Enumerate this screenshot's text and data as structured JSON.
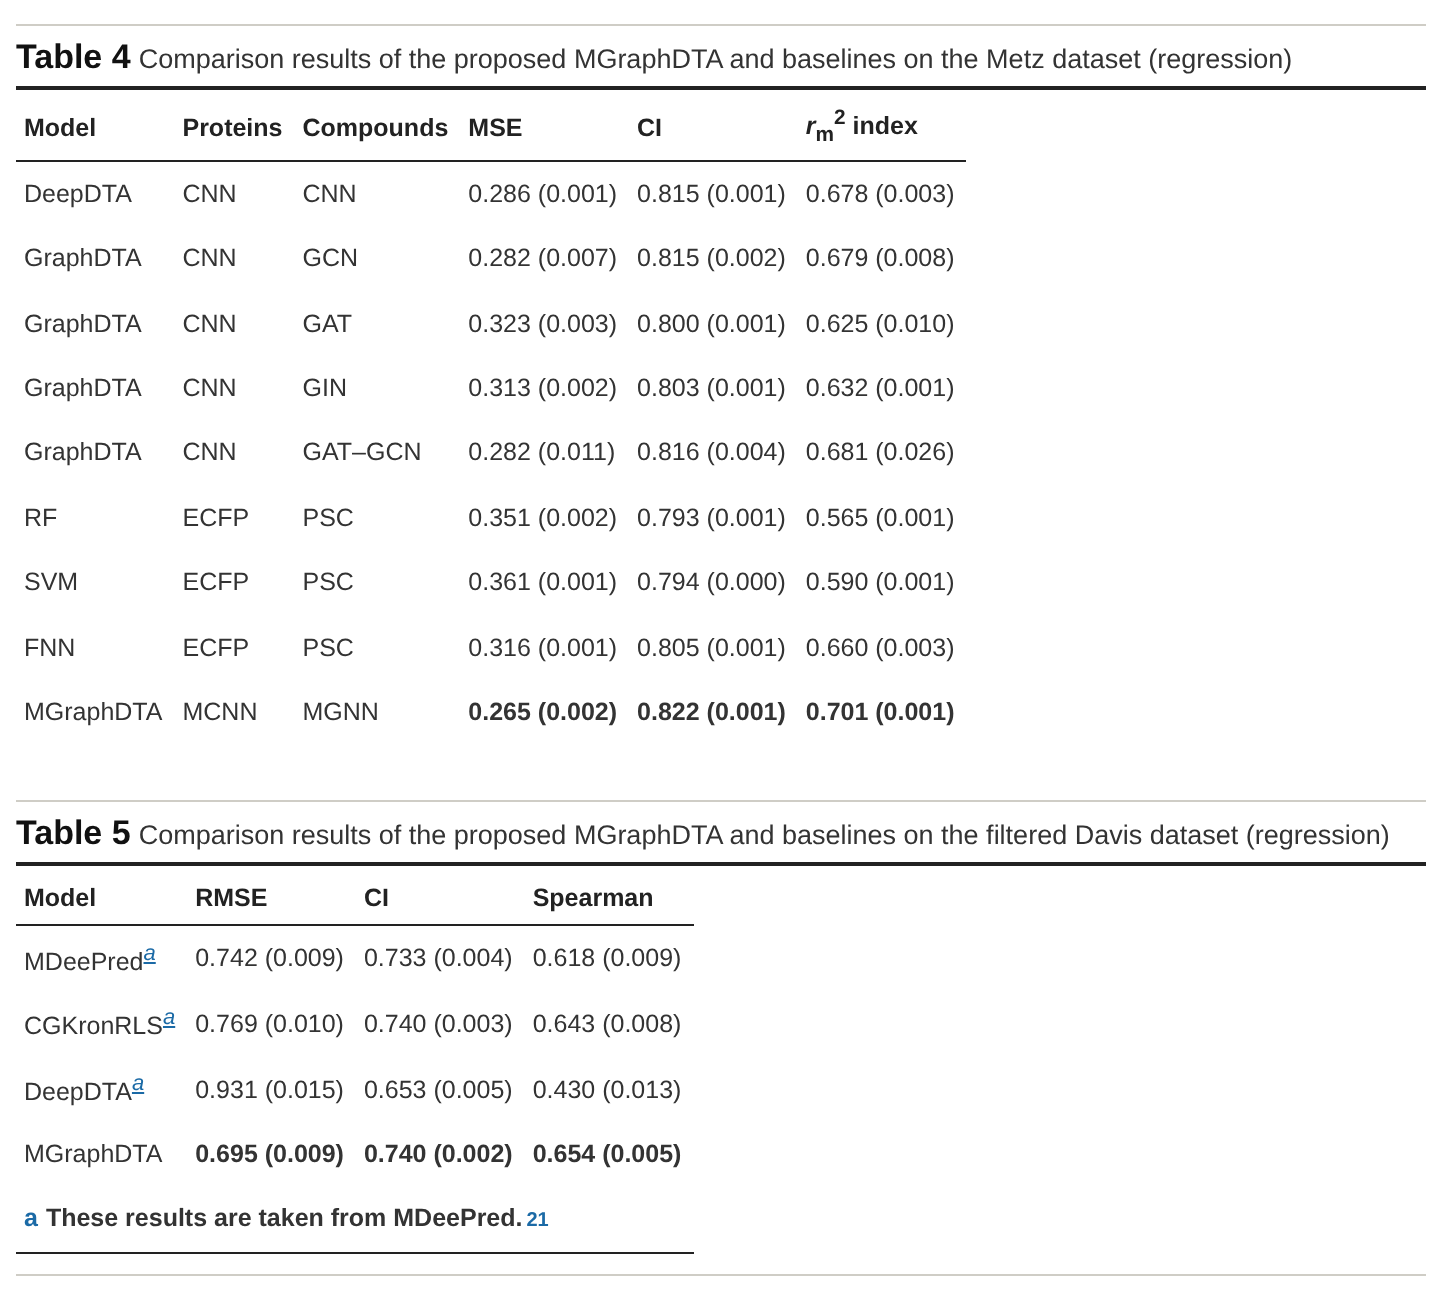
{
  "tables": [
    {
      "label": "Table 4",
      "caption": "Comparison results of the proposed MGraphDTA and baselines on the Metz dataset (regression)",
      "columns": [
        "Model",
        "Proteins",
        "Compounds",
        "MSE",
        "CI",
        "*r*$_{m}$$^{2}$ index"
      ],
      "rows": [
        {
          "cells": [
            "DeepDTA",
            "CNN",
            "CNN",
            "0.286 (0.001)",
            "0.815 (0.001)",
            "0.678 (0.003)"
          ],
          "best": false
        },
        {
          "cells": [
            "GraphDTA",
            "CNN",
            "GCN",
            "0.282 (0.007)",
            "0.815 (0.002)",
            "0.679 (0.008)"
          ],
          "best": false
        },
        {
          "cells": [
            "GraphDTA",
            "CNN",
            "GAT",
            "0.323 (0.003)",
            "0.800 (0.001)",
            "0.625 (0.010)"
          ],
          "best": false
        },
        {
          "cells": [
            "GraphDTA",
            "CNN",
            "GIN",
            "0.313 (0.002)",
            "0.803 (0.001)",
            "0.632 (0.001)"
          ],
          "best": false
        },
        {
          "cells": [
            "GraphDTA",
            "CNN",
            "GAT–GCN",
            "0.282 (0.011)",
            "0.816 (0.004)",
            "0.681 (0.026)"
          ],
          "best": false
        },
        {
          "cells": [
            "RF",
            "ECFP",
            "PSC",
            "0.351 (0.002)",
            "0.793 (0.001)",
            "0.565 (0.001)"
          ],
          "best": false
        },
        {
          "cells": [
            "SVM",
            "ECFP",
            "PSC",
            "0.361 (0.001)",
            "0.794 (0.000)",
            "0.590 (0.001)"
          ],
          "best": false
        },
        {
          "cells": [
            "FNN",
            "ECFP",
            "PSC",
            "0.316 (0.001)",
            "0.805 (0.001)",
            "0.660 (0.003)"
          ],
          "best": false
        },
        {
          "cells": [
            "MGraphDTA",
            "MCNN",
            "MGNN",
            "0.265 (0.002)",
            "0.822 (0.001)",
            "0.701 (0.001)"
          ],
          "best": true
        }
      ]
    },
    {
      "label": "Table 5",
      "caption": "Comparison results of the proposed MGraphDTA and baselines on the filtered Davis dataset (regression)",
      "columns": [
        "Model",
        "RMSE",
        "CI",
        "Spearman"
      ],
      "rows": [
        {
          "cells": [
            "MDeePred",
            "0.742 (0.009)",
            "0.733 (0.004)",
            "0.618 (0.009)"
          ],
          "best": false,
          "note": "a"
        },
        {
          "cells": [
            "CGKronRLS",
            "0.769 (0.010)",
            "0.740 (0.003)",
            "0.643 (0.008)"
          ],
          "best": false,
          "note": "a"
        },
        {
          "cells": [
            "DeepDTA",
            "0.931 (0.015)",
            "0.653 (0.005)",
            "0.430 (0.013)"
          ],
          "best": false,
          "note": "a"
        },
        {
          "cells": [
            "MGraphDTA",
            "0.695 (0.009)",
            "0.740 (0.002)",
            "0.654 (0.005)"
          ],
          "best": true
        }
      ],
      "footnote": {
        "mark": "a",
        "text": "These results are taken from MDeePred.",
        "ref": "21"
      }
    }
  ]
}
